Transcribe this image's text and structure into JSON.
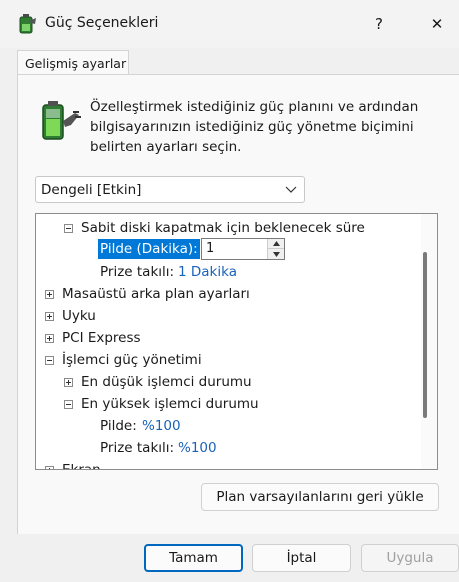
{
  "window": {
    "title": "Güç Seçenekleri",
    "help_glyph": "?",
    "close_glyph": "✕"
  },
  "tabs": [
    {
      "label": "Gelişmiş ayarlar",
      "active": true
    }
  ],
  "intro_text": "Özelleştirmek istediğiniz güç planını ve ardından bilgisayarınızın istediğiniz güç yönetme biçimini belirten ayarları seçin.",
  "plan_select": {
    "value": "Dengeli [Etkin]"
  },
  "tree": {
    "hdd_group": {
      "label": "Sabit diski kapatmak için beklenecek süre",
      "expanded": true
    },
    "hdd_battery": {
      "label": "Pilde (Dakika):",
      "value": "1",
      "selected": true
    },
    "hdd_plugged": {
      "label": "Prize takılı:",
      "value": "1 Dakika"
    },
    "desktop_bg": {
      "label": "Masaüstü arka plan ayarları",
      "expanded": false
    },
    "sleep": {
      "label": "Uyku",
      "expanded": false
    },
    "pci": {
      "label": "PCI Express",
      "expanded": false
    },
    "cpu": {
      "label": "İşlemci güç yönetimi",
      "expanded": true
    },
    "cpu_min": {
      "label": "En düşük işlemci durumu",
      "expanded": false
    },
    "cpu_max": {
      "label": "En yüksek işlemci durumu",
      "expanded": true
    },
    "cpu_max_battery": {
      "label": "Pilde:",
      "value": "%100"
    },
    "cpu_max_plugged": {
      "label": "Prize takılı:",
      "value": "%100"
    },
    "display": {
      "label": "Ekran",
      "expanded": false
    }
  },
  "buttons": {
    "restore": "Plan varsayılanlarını geri yükle",
    "ok": "Tamam",
    "cancel": "İptal",
    "apply": "Uygula"
  },
  "colors": {
    "accent": "#0078d7",
    "link": "#1a62b8"
  }
}
